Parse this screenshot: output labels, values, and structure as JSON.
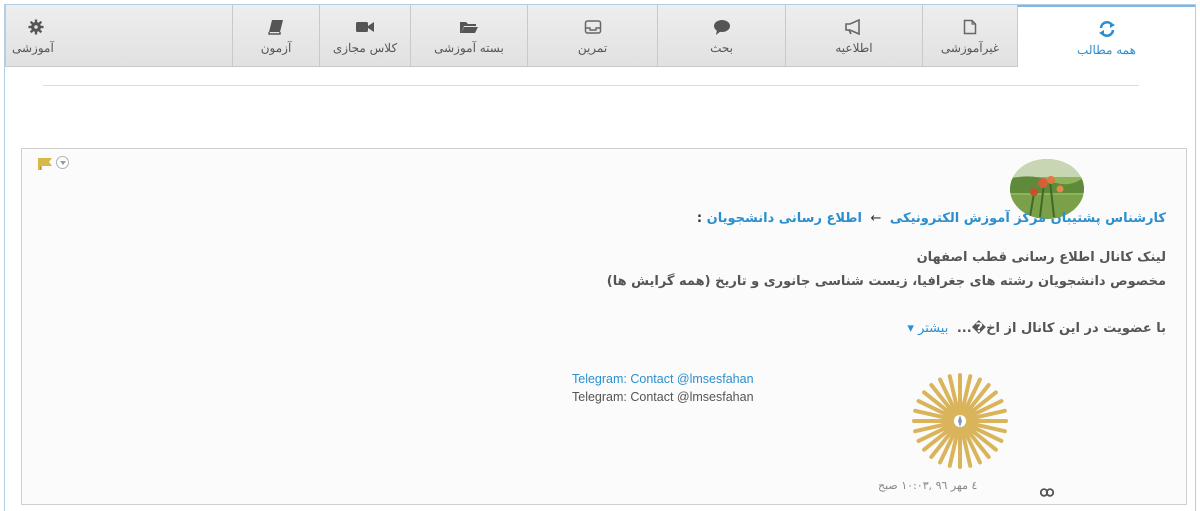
{
  "tabs": [
    {
      "label": "همه مطالب",
      "icon": "refresh-icon",
      "active": true
    },
    {
      "label": "غیرآموزشی",
      "icon": "document-icon",
      "active": false
    },
    {
      "label": "اطلاعیه",
      "icon": "megaphone-icon",
      "active": false
    },
    {
      "label": "بحث",
      "icon": "speech-bubble-icon",
      "active": false
    },
    {
      "label": "تمرین",
      "icon": "inbox-icon",
      "active": false
    },
    {
      "label": "بسته آموزشی",
      "icon": "folder-icon",
      "active": false
    },
    {
      "label": "کلاس مجازی",
      "icon": "video-camera-icon",
      "active": false
    },
    {
      "label": "آزمون",
      "icon": "book-icon",
      "active": false
    },
    {
      "label": "آموزشی",
      "icon": "gear-icon",
      "active": false
    }
  ],
  "post": {
    "author": "کارشناس پشتیبان مرکز آموزش الکترونیکی",
    "arrow": "←",
    "target": "اطلاع رسانی دانشجویان",
    "colon": ":",
    "line1": "لینک کانال اطلاع رسانی قطب اصفهان",
    "line2": "مخصوص دانشجویان رشته های جغرافیا، زیست شناسی جانوری و تاریخ (همه گرایش ها)",
    "line3": "با عضویت در این کانال از اخ�...",
    "more_label": "بیشتر ▾",
    "link_title": "Telegram: Contact @lmsesfahan",
    "link_text": "Telegram: Contact @lmsesfahan",
    "timestamp": "٤ مهر ٩٦ ,١٠:٠٣ صبح"
  },
  "colors": {
    "accent": "#2b8fcf",
    "logo_gold": "#d9b45a"
  }
}
